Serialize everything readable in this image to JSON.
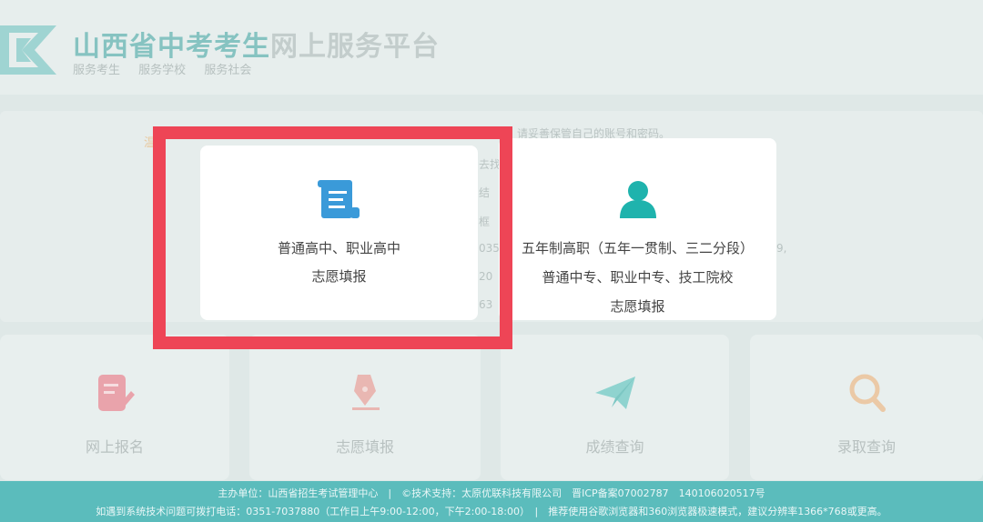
{
  "header": {
    "title_part1": "山西省中考考生",
    "title_part2": "网上服务平台",
    "sub_nav": [
      "服务考生",
      "服务学校",
      "服务社会"
    ]
  },
  "notice": {
    "label": "温",
    "text": "请妥善保管自己的账号和密码。",
    "peek_fragments": [
      "去找",
      "结",
      "框",
      "035",
      "20",
      "63",
      "9,"
    ]
  },
  "modal": {
    "option1": {
      "icon": "scroll-document-icon",
      "line1": "普通高中、职业高中",
      "line2": "志愿填报"
    },
    "option2": {
      "icon": "person-icon",
      "line1": "五年制高职（五年一贯制、三二分段）",
      "line2": "普通中专、职业中专、技工院校",
      "line3": "志愿填报"
    }
  },
  "cards": [
    {
      "label": "网上报名",
      "icon": "edit-form-icon",
      "color": "#e9a3ab"
    },
    {
      "label": "志愿填报",
      "icon": "pen-nib-icon",
      "color": "#e9b7b2"
    },
    {
      "label": "成绩查询",
      "icon": "paper-plane-icon",
      "color": "#8fd3cf"
    },
    {
      "label": "录取查询",
      "icon": "magnifier-icon",
      "color": "#ebc9a6"
    }
  ],
  "footer": {
    "line1": "主办单位：山西省招生考试管理中心　|　©技术支持：太原优联科技有限公司　晋ICP备案07002787　14010602051​7号",
    "line2": "如遇到系统技术问题可拨打电话：0351-7037880（工作日上午9:00-12:00，下午2:00-18:00）　|　推荐使用谷歌浏览器和360浏览器极速模式，建议分辨率1366*768或更高。"
  },
  "colors": {
    "highlight": "#ee4556",
    "teal": "#1fb3ad",
    "blue": "#3a9ad9"
  }
}
